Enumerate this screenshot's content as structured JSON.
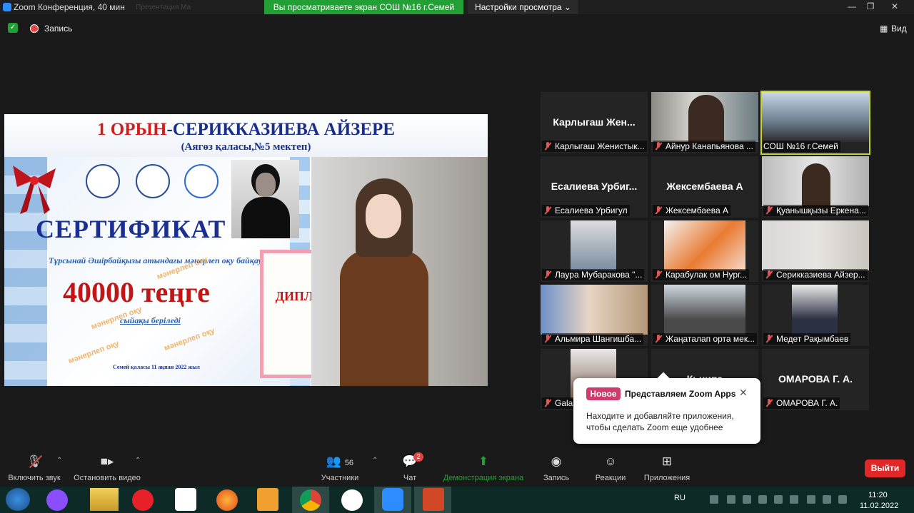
{
  "window": {
    "title": "Zoom Конференция, 40 мин",
    "ghost_tabs": "Презентация    Ма",
    "share_banner": "Вы просматриваете экран СОШ №16 г.Семей",
    "view_options": "Настройки просмотра",
    "min": "—",
    "max": "❐",
    "close": "✕"
  },
  "status": {
    "record": "Запись",
    "view": "Вид"
  },
  "slide": {
    "title_red": "1 ОРЫН",
    "title_blue": "-СЕРИККАЗИЕВА АЙЗЕРЕ",
    "subtitle": "(Аягөз қаласы,№5 мектеп)",
    "cert_word": "СЕРТИФИКАТ",
    "contest_line": "Тұрсынай Әшірбайқызы атындағы мәнерлеп оқу байқауы",
    "prize": "40000 теңге",
    "prize_sub": "сыйақы беріледі",
    "watermark": "мәнерлеп оқу",
    "footer": "Семей қаласы 11 ақпан 2022 жыл",
    "diploma_title": "ДИПЛОМ",
    "ribbon_color": "#c0141c"
  },
  "participants": [
    {
      "big": "Карлыгаш  Жен...",
      "label": "Карлыгаш Женистык..."
    },
    {
      "big": "",
      "label": "Айнур Канапьянова ..."
    },
    {
      "big": "",
      "label": "СОШ №16 г.Семей"
    },
    {
      "big": "Есалиева  Урбиг...",
      "label": "Есалиева Урбигул"
    },
    {
      "big": "Жексембаева А",
      "label": "Жексембаева А"
    },
    {
      "big": "",
      "label": "Қуанышқызы Еркена..."
    },
    {
      "big": "",
      "label": "Лаура Мубаракова \"..."
    },
    {
      "big": "",
      "label": "Карабулак ом    Нург..."
    },
    {
      "big": "",
      "label": "Серикказиева Айзер..."
    },
    {
      "big": "",
      "label": "Альмира Шангишба..."
    },
    {
      "big": "",
      "label": "Жаңаталап орта мек..."
    },
    {
      "big": "",
      "label": "Медет Рақымбаев"
    },
    {
      "big": "",
      "label": "Gala"
    },
    {
      "big": "Кьнипа",
      "label": ""
    },
    {
      "big": "ОМАРОВА Г. А.",
      "label": "ОМАРОВА Г. А."
    }
  ],
  "popup": {
    "badge": "Новое",
    "title": "Представляем Zoom Apps",
    "body": "Находите и добавляйте приложения, чтобы сделать Zoom еще удобнее"
  },
  "toolbar": {
    "unmute": "Включить звук",
    "video": "Остановить видео",
    "participants": "Участники",
    "participants_count": "56",
    "chat": "Чат",
    "chat_badge": "2",
    "share": "Демонстрация экрана",
    "record": "Запись",
    "reactions": "Реакции",
    "apps": "Приложения",
    "leave": "Выйти"
  },
  "taskbar": {
    "lang": "RU",
    "time": "11:20",
    "date": "11.02.2022"
  },
  "colors": {
    "share_green": "#23a035",
    "leave_red": "#e02828",
    "active_outline": "#c6d62a",
    "new_badge": "#d13b6b"
  }
}
